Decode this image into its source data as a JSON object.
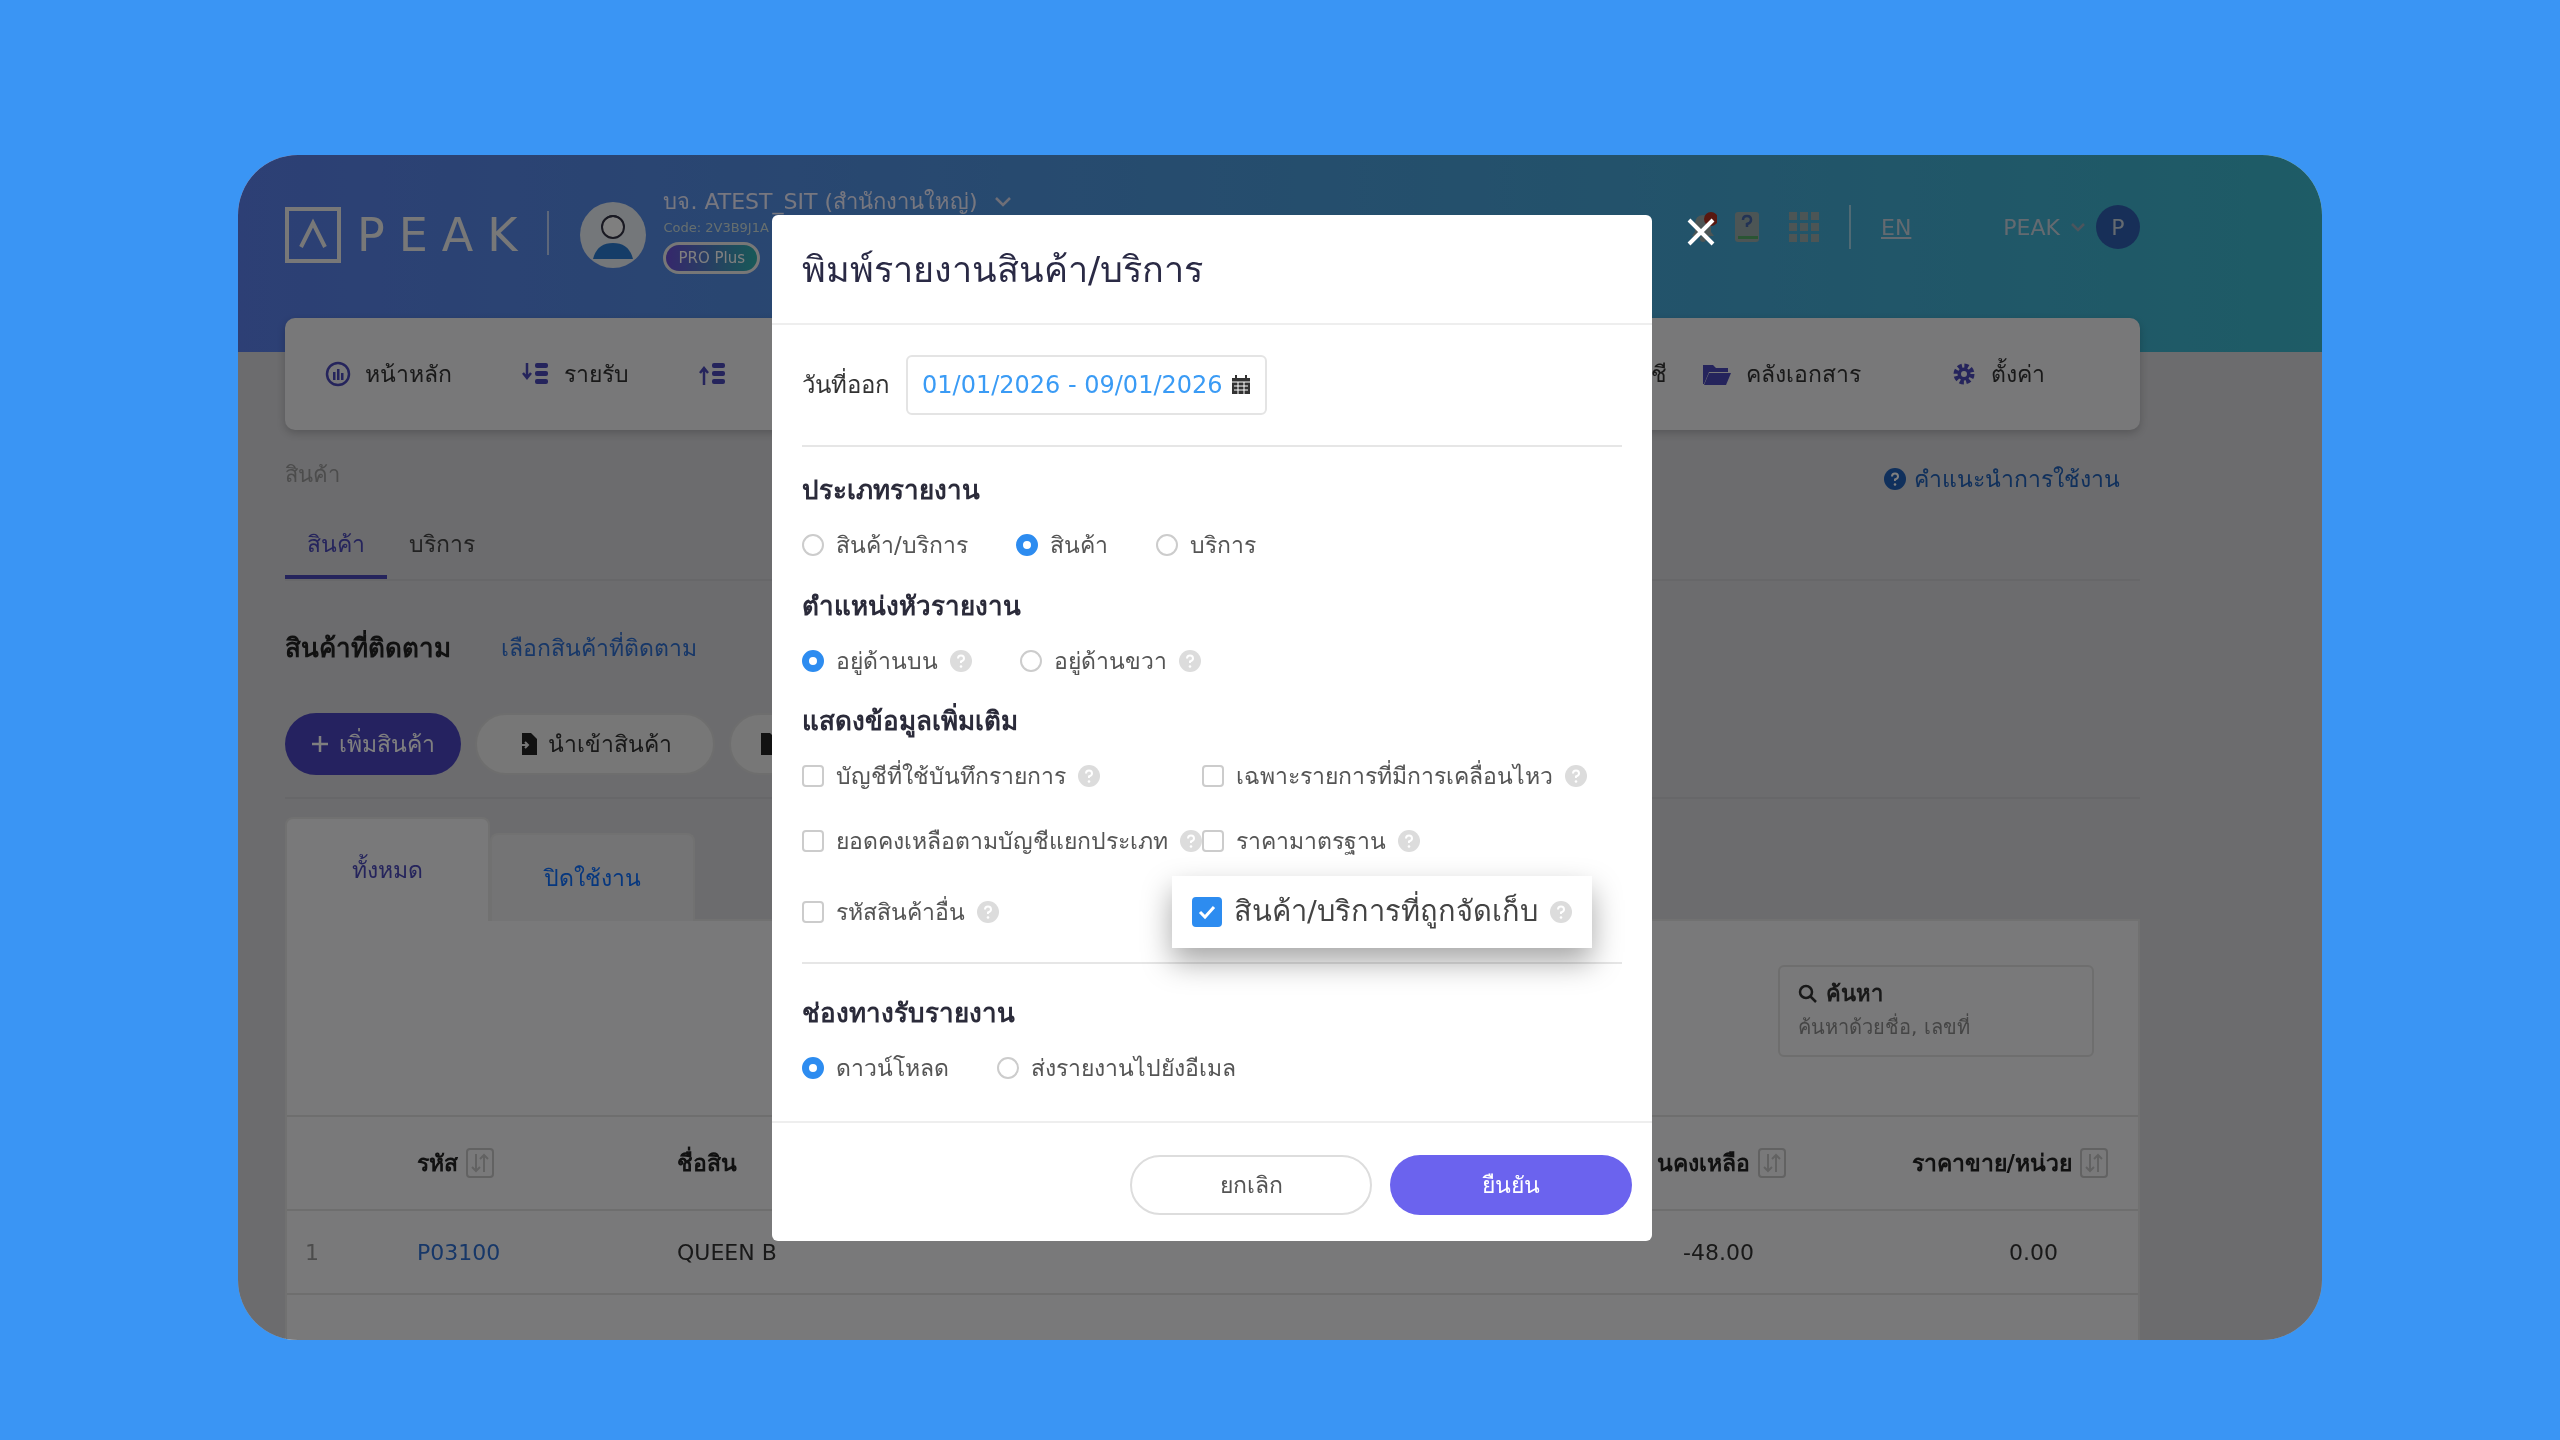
{
  "app": {
    "logo": "PEAK",
    "company": {
      "name": "บจ. ATEST_SIT (สำนักงานใหญ่)",
      "code": "Code: 2V3B9J1A",
      "plan": "PRO Plus"
    },
    "header_right": {
      "language": "EN",
      "user": "PEAK",
      "avatar": "P"
    },
    "nav": [
      {
        "label": "หน้าหลัก",
        "kind": "gauge"
      },
      {
        "label": "รายรับ",
        "kind": "income"
      },
      {
        "kind": "expense"
      },
      {
        "label": "ชี",
        "kind": "text"
      },
      {
        "label": "คลังเอกสาร",
        "kind": "folder"
      },
      {
        "label": "ตั้งค่า",
        "kind": "gear"
      }
    ],
    "breadcrumb": "สินค้า",
    "tabs": [
      {
        "label": "สินค้า",
        "selected": true
      },
      {
        "label": "บริการ",
        "selected": false
      }
    ],
    "help_link": "คำแนะนำการใช้งาน",
    "tracked": {
      "title": "สินค้าที่ติดตาม",
      "link": "เลือกสินค้าที่ติดตาม"
    },
    "actions": [
      {
        "label": "เพิ่มสินค้า",
        "kind": "primary"
      },
      {
        "label": "นำเข้าสินค้า",
        "kind": "import"
      },
      {
        "kind": "partial"
      }
    ],
    "list_tabs": [
      {
        "label": "ทั้งหมด",
        "selected": true
      },
      {
        "label": "ปิดใช้งาน",
        "selected": false
      }
    ],
    "search": {
      "label": "ค้นหา",
      "placeholder": "ค้นหาด้วยชื่อ, เลขที่"
    },
    "table": {
      "columns": [
        {
          "label": "รหัส",
          "sortable": true
        },
        {
          "label": "ชื่อสิน",
          "sortable": false
        },
        {
          "label": "นคงเหลือ",
          "sortable": true
        },
        {
          "label": "ราคาขาย/หน่วย",
          "sortable": true
        }
      ],
      "rows": [
        {
          "index": "1",
          "code": "P03100",
          "name": "QUEEN B",
          "balance": "-48.00",
          "price": "0.00"
        }
      ]
    }
  },
  "modal": {
    "title": "พิมพ์รายงานสินค้า/บริการ",
    "date": {
      "label": "วันที่ออก",
      "value": "01/01/2026 - 09/01/2026"
    },
    "sections": [
      {
        "title": "ประเภทรายงาน",
        "kind": "radio",
        "options": [
          {
            "label": "สินค้า/บริการ",
            "selected": false
          },
          {
            "label": "สินค้า",
            "selected": true
          },
          {
            "label": "บริการ",
            "selected": false
          }
        ]
      },
      {
        "title": "ตำแหน่งหัวรายงาน",
        "kind": "radio",
        "options": [
          {
            "label": "อยู่ด้านบน",
            "selected": true,
            "help": true
          },
          {
            "label": "อยู่ด้านขวา",
            "selected": false,
            "help": true
          }
        ]
      },
      {
        "title": "แสดงข้อมูลเพิ่มเติม",
        "kind": "checkbox",
        "options": [
          {
            "label": "บัญชีที่ใช้บันทึกรายการ",
            "checked": false,
            "help": true,
            "highlighted": false
          },
          {
            "label": "เฉพาะรายการที่มีการเคลื่อนไหว",
            "checked": false,
            "help": true,
            "highlighted": false
          },
          {
            "label": "ยอดคงเหลือตามบัญชีแยกประเภท",
            "checked": false,
            "help": true,
            "highlighted": false
          },
          {
            "label": "ราคามาตรฐาน",
            "checked": false,
            "help": true,
            "highlighted": false
          },
          {
            "label": "รหัสสินค้าอื่น",
            "checked": false,
            "help": true,
            "highlighted": false
          },
          {
            "label": "สินค้า/บริการที่ถูกจัดเก็บ",
            "checked": true,
            "help": true,
            "highlighted": true
          }
        ]
      },
      {
        "title": "ช่องทางรับรายงาน",
        "kind": "radio",
        "options": [
          {
            "label": "ดาวน์โหลด",
            "selected": true
          },
          {
            "label": "ส่งรายงานไปยังอีเมล",
            "selected": false
          }
        ]
      }
    ],
    "buttons": [
      {
        "label": "ยกเลิก",
        "kind": "secondary"
      },
      {
        "label": "ยืนยัน",
        "kind": "primary"
      }
    ]
  }
}
